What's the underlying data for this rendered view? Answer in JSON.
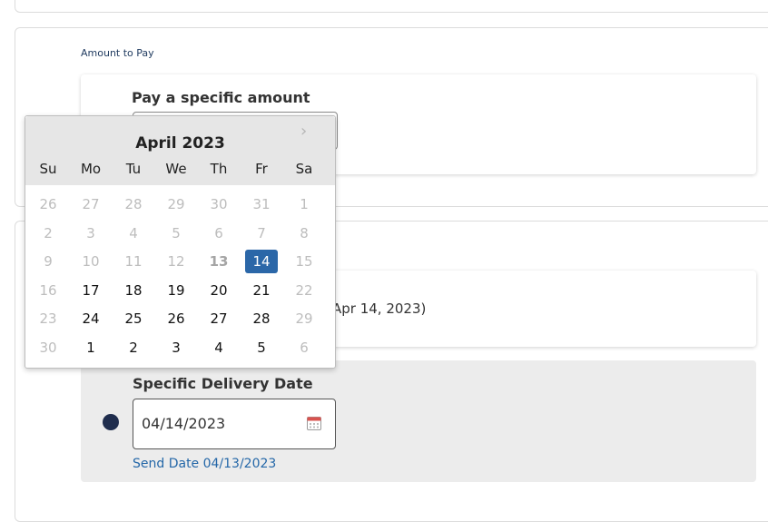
{
  "amount_section": {
    "label": "Amount to Pay",
    "option_title": "Pay a specific amount"
  },
  "delivery_section": {
    "option_1_text": "Apr 14, 2023)",
    "option_2_title": "Specific Delivery Date",
    "date_value": "04/14/2023",
    "send_date": "Send Date 04/13/2023"
  },
  "datepicker": {
    "month_label": "April 2023",
    "next_icon": "chevron-right-icon",
    "weekdays": [
      "Su",
      "Mo",
      "Tu",
      "We",
      "Th",
      "Fr",
      "Sa"
    ],
    "weeks": [
      [
        {
          "d": "26",
          "s": "muted"
        },
        {
          "d": "27",
          "s": "muted"
        },
        {
          "d": "28",
          "s": "muted"
        },
        {
          "d": "29",
          "s": "muted"
        },
        {
          "d": "30",
          "s": "muted"
        },
        {
          "d": "31",
          "s": "muted"
        },
        {
          "d": "1",
          "s": "muted"
        }
      ],
      [
        {
          "d": "2",
          "s": "muted"
        },
        {
          "d": "3",
          "s": "muted"
        },
        {
          "d": "4",
          "s": "muted"
        },
        {
          "d": "5",
          "s": "muted"
        },
        {
          "d": "6",
          "s": "muted"
        },
        {
          "d": "7",
          "s": "muted"
        },
        {
          "d": "8",
          "s": "muted"
        }
      ],
      [
        {
          "d": "9",
          "s": "muted"
        },
        {
          "d": "10",
          "s": "muted"
        },
        {
          "d": "11",
          "s": "muted"
        },
        {
          "d": "12",
          "s": "muted"
        },
        {
          "d": "13",
          "s": "today"
        },
        {
          "d": "14",
          "s": "selected"
        },
        {
          "d": "15",
          "s": "muted"
        }
      ],
      [
        {
          "d": "16",
          "s": "muted"
        },
        {
          "d": "17",
          "s": "active"
        },
        {
          "d": "18",
          "s": "active"
        },
        {
          "d": "19",
          "s": "active"
        },
        {
          "d": "20",
          "s": "active"
        },
        {
          "d": "21",
          "s": "active"
        },
        {
          "d": "22",
          "s": "muted"
        }
      ],
      [
        {
          "d": "23",
          "s": "muted"
        },
        {
          "d": "24",
          "s": "active"
        },
        {
          "d": "25",
          "s": "active"
        },
        {
          "d": "26",
          "s": "active"
        },
        {
          "d": "27",
          "s": "active"
        },
        {
          "d": "28",
          "s": "active"
        },
        {
          "d": "29",
          "s": "muted"
        }
      ],
      [
        {
          "d": "30",
          "s": "muted"
        },
        {
          "d": "1",
          "s": "active"
        },
        {
          "d": "2",
          "s": "active"
        },
        {
          "d": "3",
          "s": "active"
        },
        {
          "d": "4",
          "s": "active"
        },
        {
          "d": "5",
          "s": "active"
        },
        {
          "d": "6",
          "s": "muted"
        }
      ]
    ]
  },
  "colors": {
    "accent": "#2b67a8",
    "radio": "#1f2d4d",
    "link": "#2467a8"
  }
}
